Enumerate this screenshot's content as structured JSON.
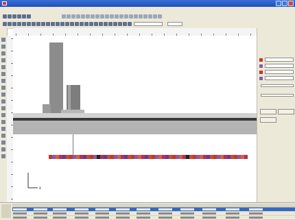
{
  "app": {
    "title": "",
    "menu": [
      "",
      "",
      "",
      "",
      "",
      "",
      "",
      "",
      ""
    ],
    "toolbar_field_1": "",
    "toolbar_field_2": ""
  },
  "ruler": {
    "ticks_h": 20,
    "ticks_v": 14
  },
  "right_panel": {
    "section_title": "",
    "value_rows": [
      "",
      "",
      "",
      ""
    ],
    "slider_rows": [
      "",
      ""
    ],
    "buttons": [
      "",
      "",
      ""
    ]
  },
  "bottom_grid": {
    "columns": [
      "",
      "",
      "",
      "",
      "",
      "",
      "",
      "",
      "",
      "",
      "",
      ""
    ],
    "rows": 3
  },
  "canvas": {
    "axis_label": "x"
  },
  "colors": {
    "title_bar": "#1f4fb8",
    "chrome": "#ece9d8",
    "selection": "#316ac5",
    "strip_red": "#c0392b",
    "strip_violet": "#8a5aa8"
  }
}
